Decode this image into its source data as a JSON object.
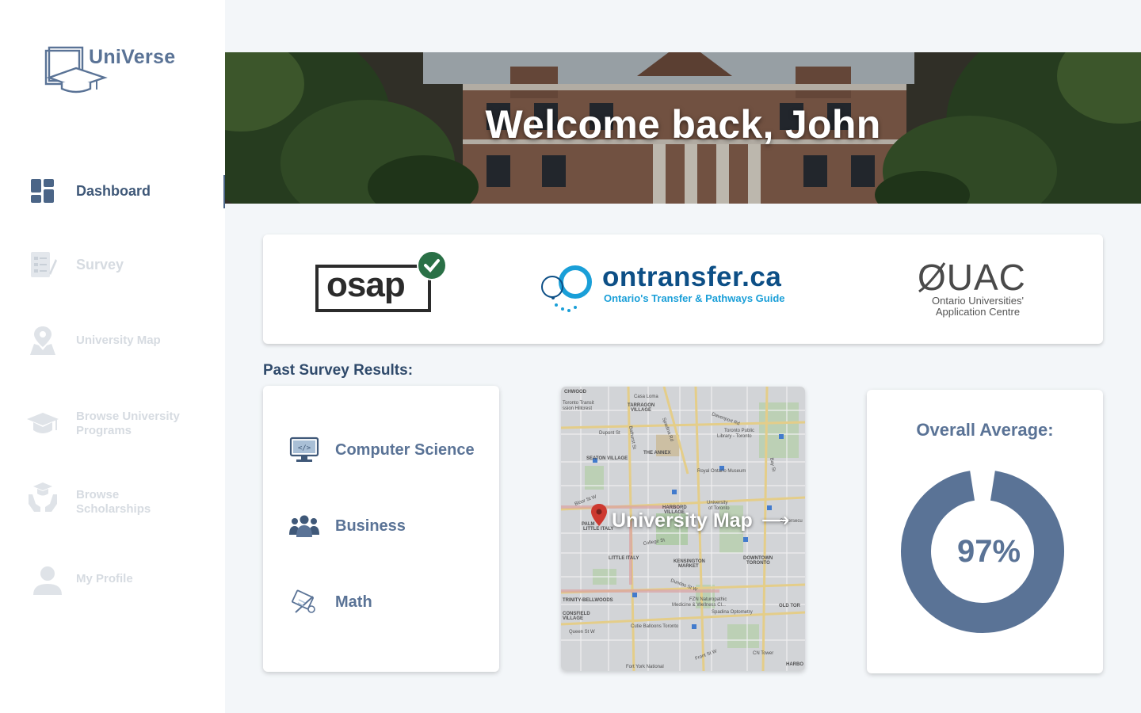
{
  "app": {
    "name": "UniVerse"
  },
  "sidebar": {
    "items": [
      {
        "label": "Dashboard",
        "active": true
      },
      {
        "label": "Survey"
      },
      {
        "label": "University Map"
      },
      {
        "label": "Browse University Programs"
      },
      {
        "label": "Browse Scholarships"
      },
      {
        "label": "My Profile"
      }
    ]
  },
  "banner": {
    "title": "Welcome back, John"
  },
  "partners": {
    "osap": {
      "text": "osap"
    },
    "ontransfer": {
      "name": "ontransfer.ca",
      "tagline": "Ontario's Transfer & Pathways Guide"
    },
    "ouac": {
      "name": "OUAC",
      "line1": "Ontario Universities'",
      "line2": "Application Centre"
    }
  },
  "survey": {
    "title": "Past Survey Results:",
    "results": [
      {
        "label": "Computer Science",
        "icon": "monitor-code-icon"
      },
      {
        "label": "Business",
        "icon": "people-group-icon"
      },
      {
        "label": "Math",
        "icon": "math-tools-icon"
      }
    ]
  },
  "map": {
    "label": "University Map",
    "arrow": "⟶",
    "places": {
      "casa_loma": "Casa Loma",
      "tarragon": "TARRAGON",
      "village1": "VILLAGE",
      "toronto_transit": "Toronto Transit",
      "hillcrest": "ssion Hillcrest",
      "chwood": "CHWOOD",
      "dupont": "Dupont St",
      "bathurst": "Bathurst St",
      "spadina": "Spadina Rd",
      "seaton": "SEATON VILLAGE",
      "annex": "THE ANNEX",
      "tpl1": "Toronto Public",
      "tpl2": "Library - Toronto",
      "rom": "Royal Ontario Museum",
      "harbord1": "HARBORD",
      "harbord2": "VILLAGE",
      "uoft1": "University",
      "uoft2": "of Toronto",
      "palmerston": "PALM",
      "little_italy_a": "LITTLE ITALY",
      "little_italy_b": "LITTLE ITALY",
      "kensington1": "KENSINGTON",
      "kensington2": "MARKET",
      "downtown1": "DOWNTOWN",
      "downtown2": "TORONTO",
      "cyber": "Cybersecu",
      "trinity": "TRINITY-BELLWOODS",
      "fzn1": "FZN Naturopathic",
      "fzn2": "Medicine & Wellness Cl...",
      "spadina_opt": "Spadina Optometry",
      "old_tor": "OLD TOR",
      "consfield1": "CONSFIELD",
      "consfield2": "VILLAGE",
      "cutie": "Cutie Balloons Toronto",
      "queen": "Queen St W",
      "cn": "CN Tower",
      "fort_york": "Fort York National",
      "bloor": "Bloor St W",
      "college": "College St",
      "dundas": "Dundas St W",
      "front": "Front St W",
      "bay": "Bay St",
      "davenport": "Davenport Rd",
      "harbo": "HARBO"
    }
  },
  "average": {
    "title": "Overall Average:",
    "value": "97%",
    "percent": 97
  },
  "colors": {
    "accent": "#5a7396",
    "dark": "#3f5878",
    "nav_inactive": "#d6dbe1"
  }
}
